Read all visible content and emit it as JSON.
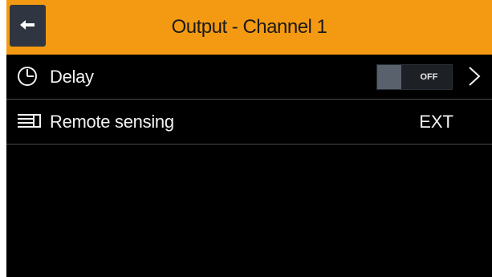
{
  "header": {
    "title": "Output - Channel 1",
    "back_icon": "arrow-left-icon",
    "accent_color": "#f49a12"
  },
  "rows": [
    {
      "label": "Delay",
      "icon": "clock-icon",
      "toggle_state": "OFF",
      "trailing_icon": "chevron-right-icon"
    },
    {
      "label": "Remote sensing",
      "icon": "remote-sensing-icon",
      "value": "EXT"
    }
  ]
}
